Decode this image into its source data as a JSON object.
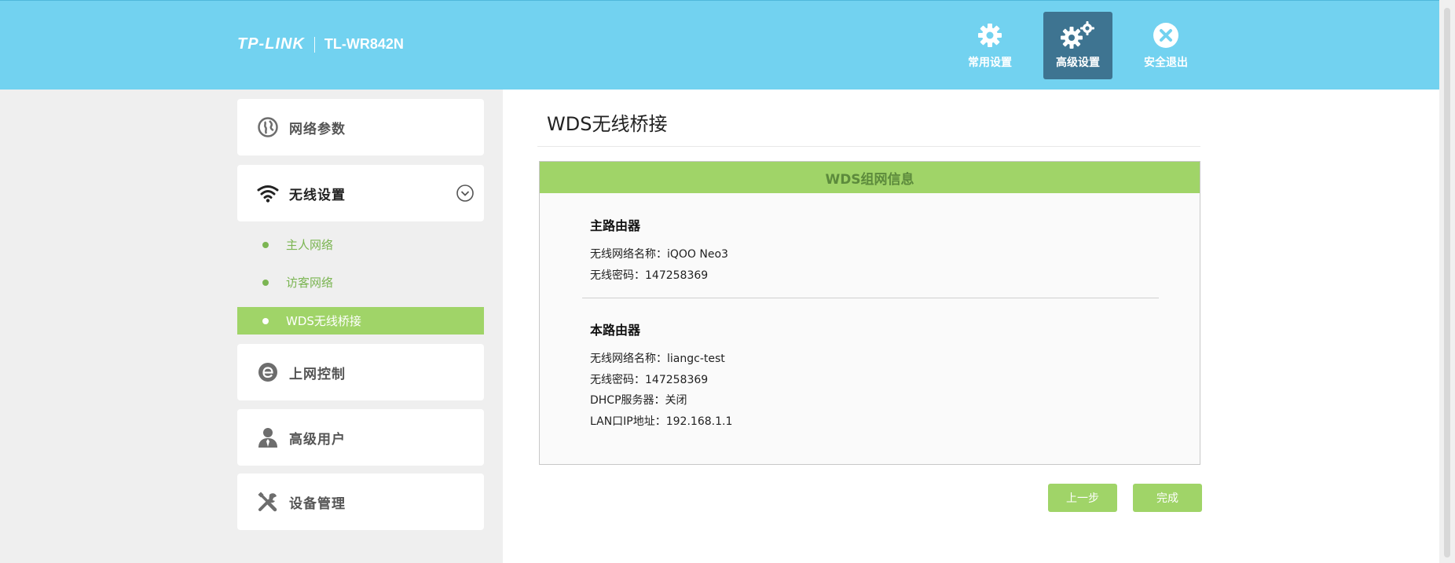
{
  "header": {
    "brand_logo": "TP-LINK",
    "model": "TL-WR842N",
    "nav": [
      {
        "label": "常用设置",
        "icon": "gear-icon"
      },
      {
        "label": "高级设置",
        "icon": "gears-icon"
      },
      {
        "label": "安全退出",
        "icon": "close-circle-icon"
      }
    ]
  },
  "sidebar": {
    "items": [
      {
        "label": "网络参数",
        "icon": "globe-icon"
      },
      {
        "label": "无线设置",
        "icon": "wifi-icon"
      },
      {
        "label": "上网控制",
        "icon": "e-icon"
      },
      {
        "label": "高级用户",
        "icon": "user-icon"
      },
      {
        "label": "设备管理",
        "icon": "tools-icon"
      }
    ],
    "sub_items": [
      {
        "label": "主人网络"
      },
      {
        "label": "访客网络"
      },
      {
        "label": "WDS无线桥接"
      }
    ]
  },
  "main": {
    "title": "WDS无线桥接",
    "box_header": "WDS组网信息",
    "primary": {
      "heading": "主路由器",
      "ssid": "无线网络名称：iQOO Neo3",
      "password": "无线密码：147258369"
    },
    "local": {
      "heading": "本路由器",
      "ssid": "无线网络名称：liangc-test",
      "password": "无线密码：147258369",
      "dhcp": "DHCP服务器：关闭",
      "lan_ip": "LAN口IP地址：192.168.1.1"
    },
    "buttons": {
      "prev": "上一步",
      "done": "完成"
    }
  },
  "colors": {
    "header_bg": "#72d2f0",
    "active_nav": "#3e7491",
    "accent_green": "#a0d468",
    "sub_green": "#7bb552"
  }
}
